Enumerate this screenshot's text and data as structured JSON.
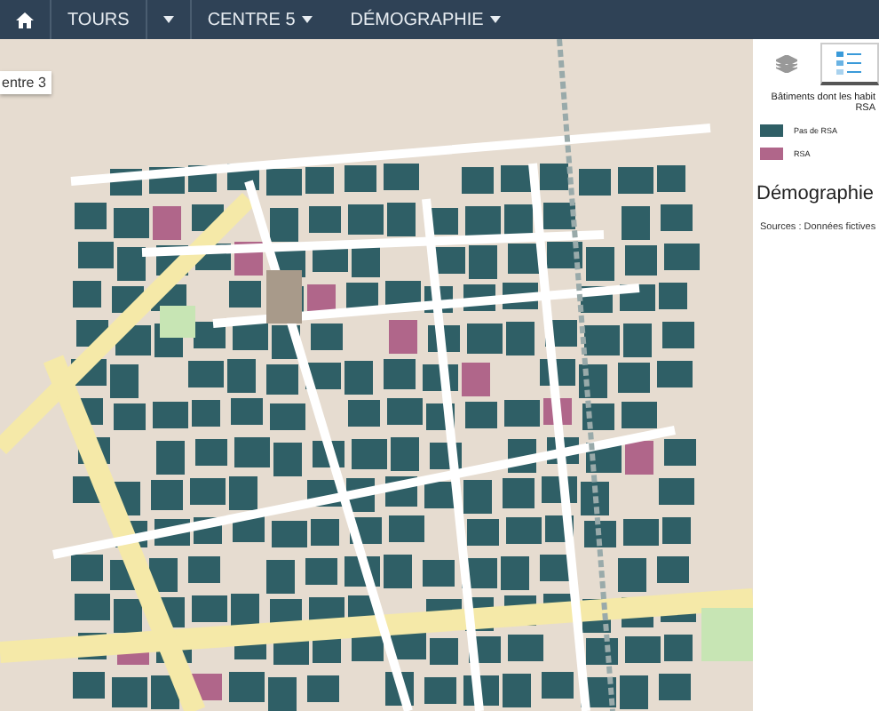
{
  "navbar": {
    "items": [
      {
        "kind": "home"
      },
      {
        "kind": "link",
        "label": "TOURS"
      },
      {
        "kind": "caret"
      },
      {
        "kind": "menu",
        "label": "CENTRE 5"
      },
      {
        "kind": "menu",
        "label": "DÉMOGRAPHIE"
      }
    ]
  },
  "map": {
    "tooltip": "entre 3"
  },
  "panel": {
    "tabs": [
      {
        "kind": "layers",
        "selected": false
      },
      {
        "kind": "legend",
        "selected": true
      }
    ],
    "legend_title": [
      "Bâtiments dont les habit",
      "RSA"
    ],
    "legend_items": [
      {
        "label": "Pas de RSA",
        "color": "#2f5f66"
      },
      {
        "label": "RSA",
        "color": "#b0668a"
      }
    ],
    "heading": "Démographie",
    "sources": "Sources : Données fictives"
  }
}
